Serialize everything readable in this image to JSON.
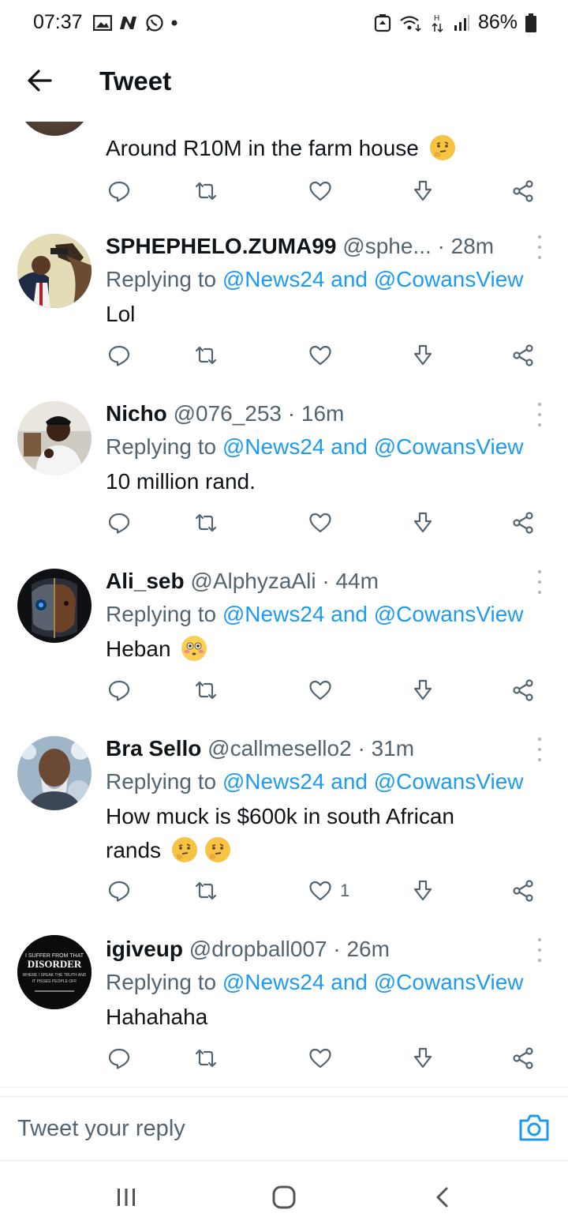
{
  "status_bar": {
    "time": "07:37",
    "battery": "86%"
  },
  "header": {
    "title": "Tweet"
  },
  "top_tweet": {
    "text": "Around R10M in the farm house"
  },
  "tweets": [
    {
      "name": "SPHEPHELO.ZUMA99",
      "handle": "@sphe...",
      "dot": "·",
      "time": "28m",
      "replying": "Replying to",
      "mention1": "@News24",
      "and": "and",
      "mention2": "@CowansView",
      "text": "Lol",
      "likes": ""
    },
    {
      "name": "Nicho",
      "handle": "@076_253",
      "dot": "·",
      "time": "16m",
      "replying": "Replying to",
      "mention1": "@News24",
      "and": "and",
      "mention2": "@CowansView",
      "text": "10 million rand.",
      "likes": ""
    },
    {
      "name": "Ali_seb",
      "handle": "@AlphyzaAli",
      "dot": "·",
      "time": "44m",
      "replying": "Replying to",
      "mention1": "@News24",
      "and": "and",
      "mention2": "@CowansView",
      "text": "Heban",
      "likes": ""
    },
    {
      "name": "Bra Sello",
      "handle": "@callmesello2",
      "dot": "·",
      "time": "31m",
      "replying": "Replying to",
      "mention1": "@News24",
      "and": "and",
      "mention2": "@CowansView",
      "text_line1": "How muck is $600k in south African",
      "text_line2": "rands",
      "likes": "1"
    },
    {
      "name": "igiveup",
      "handle": "@dropball007",
      "dot": "·",
      "time": "26m",
      "replying": "Replying to",
      "mention1": "@News24",
      "and": "and",
      "mention2": "@CowansView",
      "text": "Hahahaha",
      "likes": ""
    }
  ],
  "avatar_logo": {
    "line1": "I SUFFER FROM THAT",
    "line2": "DISORDER",
    "line3": "WHERE I SPEAK THE TRUTH AND",
    "line4": "IT PISSES PEOPLE OFF"
  },
  "reply_bar": {
    "placeholder": "Tweet your reply"
  },
  "colors": {
    "accent": "#1d9bf0",
    "text": "#0f1419",
    "secondary": "#536471"
  },
  "icons": [
    "back-arrow-icon",
    "reply-icon",
    "retweet-icon",
    "like-icon",
    "download-icon",
    "share-icon",
    "more-icon",
    "camera-icon",
    "recent-apps-icon",
    "home-icon",
    "back-nav-icon"
  ]
}
